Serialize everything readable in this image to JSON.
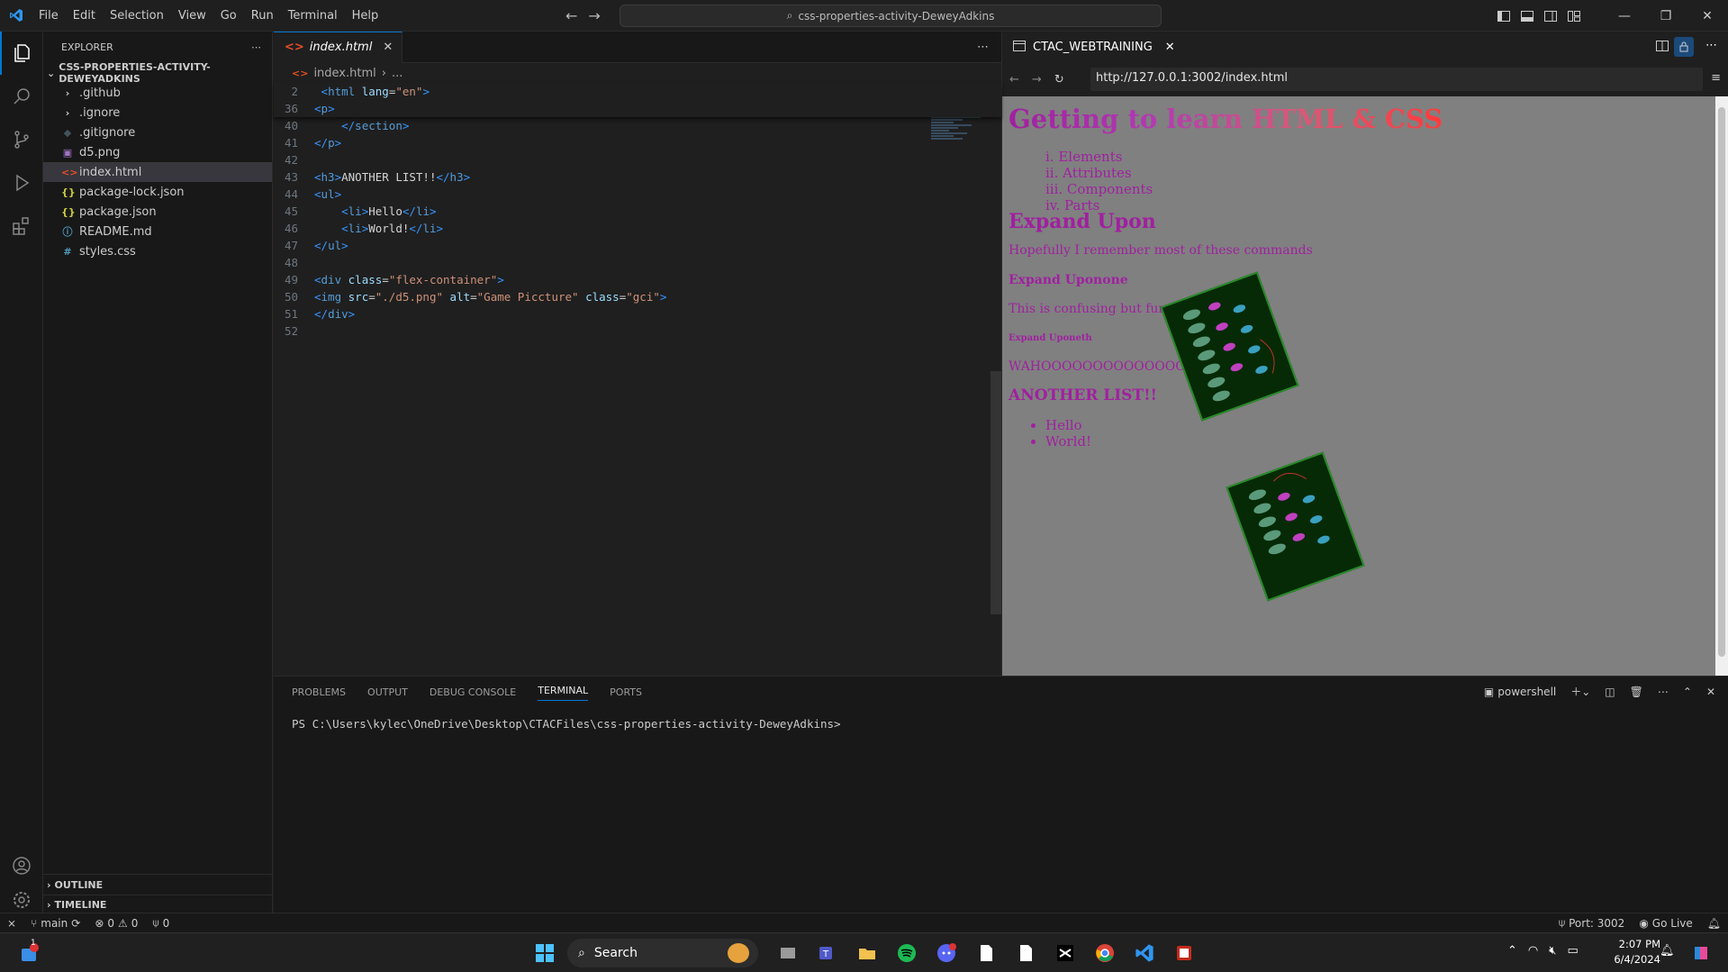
{
  "menu": [
    "File",
    "Edit",
    "Selection",
    "View",
    "Go",
    "Run",
    "Terminal",
    "Help"
  ],
  "command_center": "css-properties-activity-DeweyAdkins",
  "explorer": {
    "title": "EXPLORER",
    "folder": "CSS-PROPERTIES-ACTIVITY-DEWEYADKINS",
    "items": [
      {
        "label": ".github",
        "icon": "folder-chevron-icon",
        "color": "#cccccc"
      },
      {
        "label": ".ignore",
        "icon": "folder-chevron-icon",
        "color": "#cccccc"
      },
      {
        "label": ".gitignore",
        "icon": "git-icon",
        "color": "#41535b"
      },
      {
        "label": "d5.png",
        "icon": "image-icon",
        "color": "#a074c4"
      },
      {
        "label": "index.html",
        "icon": "html-icon",
        "color": "#e44d26"
      },
      {
        "label": "package-lock.json",
        "icon": "json-icon",
        "color": "#cbcb41"
      },
      {
        "label": "package.json",
        "icon": "json-icon",
        "color": "#cbcb41"
      },
      {
        "label": "README.md",
        "icon": "info-icon",
        "color": "#519aba"
      },
      {
        "label": "styles.css",
        "icon": "css-icon",
        "color": "#519aba"
      }
    ],
    "outline": "OUTLINE",
    "timeline": "TIMELINE"
  },
  "editor": {
    "tab": "index.html",
    "breadcrumb_file": "index.html",
    "breadcrumb_more": "...",
    "sticky_lines": [
      {
        "num": "2",
        "text": " <html lang=\"en\">"
      },
      {
        "num": "36",
        "text": "<p>"
      }
    ],
    "lines": [
      {
        "num": "40",
        "text": "    </section>"
      },
      {
        "num": "41",
        "text": "</p>"
      },
      {
        "num": "42",
        "text": ""
      },
      {
        "num": "43",
        "text": "<h3>ANOTHER LIST!!</h3>"
      },
      {
        "num": "44",
        "text": "<ul>"
      },
      {
        "num": "45",
        "text": "    <li>Hello</li>"
      },
      {
        "num": "46",
        "text": "    <li>World!</li>"
      },
      {
        "num": "47",
        "text": "</ul>"
      },
      {
        "num": "48",
        "text": ""
      },
      {
        "num": "49",
        "text": "<div class=\"flex-container\">"
      },
      {
        "num": "50",
        "text": "<img src=\"./d5.png\" alt=\"Game Piccture\" class=\"gci\">"
      },
      {
        "num": "51",
        "text": "</div>"
      },
      {
        "num": "52",
        "text": ""
      }
    ]
  },
  "preview": {
    "tab": "CTAC_WEBTRAINING",
    "url": "http://127.0.0.1:3002/index.html",
    "h1": "Getting to learn HTML & CSS",
    "ol_items": [
      "i. Elements",
      "ii. Attributes",
      "iii. Components",
      "iv. Parts"
    ],
    "h2": "Expand Upon",
    "p1": "Hopefully I remember most of these commands",
    "h3a": "Expand Uponone",
    "p2": "This is confusing but fun :D",
    "h5": "Expand Uponeth",
    "p3": "WAHOOOOOOOOOOOOOOOO",
    "h3b": "ANOTHER LIST!!",
    "ul_items": [
      "Hello",
      "World!"
    ]
  },
  "panel": {
    "tabs": [
      "PROBLEMS",
      "OUTPUT",
      "DEBUG CONSOLE",
      "TERMINAL",
      "PORTS"
    ],
    "shell": "powershell",
    "prompt": "PS C:\\Users\\kylec\\OneDrive\\Desktop\\CTACFiles\\css-properties-activity-DeweyAdkins>"
  },
  "status": {
    "branch": "main",
    "errors": "0",
    "warnings": "0",
    "ports": "0",
    "port": "Port: 3002",
    "golive": "Go Live"
  },
  "taskbar": {
    "search": "Search",
    "time": "2:07 PM",
    "date": "6/4/2024",
    "notification_count": "1"
  },
  "colors": {
    "accent": "#0078d4",
    "page_text": "#a020a0",
    "page_bg": "#808080"
  }
}
